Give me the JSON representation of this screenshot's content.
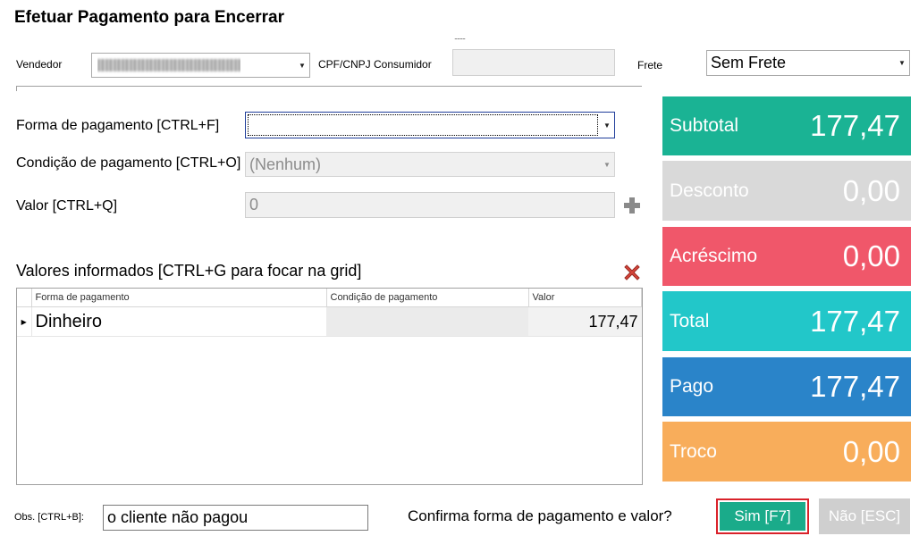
{
  "window": {
    "title": "Efetuar Pagamento para Encerrar",
    "dots": "........"
  },
  "header": {
    "vendedor_label": "Vendedor",
    "cpf_label": "CPF/CNPJ Consumidor",
    "cpf_value": "",
    "frete_label": "Frete",
    "frete_value": "Sem Frete"
  },
  "form": {
    "forma_label": "Forma de pagamento [CTRL+F]",
    "forma_value": "",
    "condicao_label": "Condição de pagamento [CTRL+O]",
    "condicao_value": "(Nenhum)",
    "valor_label": "Valor [CTRL+Q]",
    "valor_value": "0"
  },
  "grid": {
    "title": "Valores informados [CTRL+G para focar na grid]",
    "columns": [
      "Forma de pagamento",
      "Condição de pagamento",
      "Valor"
    ],
    "rows": [
      {
        "forma": "Dinheiro",
        "condicao": "",
        "valor": "177,47"
      }
    ]
  },
  "summary": [
    {
      "label": "Subtotal",
      "value": "177,47",
      "color": "#1ab394"
    },
    {
      "label": "Desconto",
      "value": "0,00",
      "color": "#d9d9d9"
    },
    {
      "label": "Acréscimo",
      "value": "0,00",
      "color": "#f0576a"
    },
    {
      "label": "Total",
      "value": "177,47",
      "color": "#22c7c9"
    },
    {
      "label": "Pago",
      "value": "177,47",
      "color": "#2a84c9"
    },
    {
      "label": "Troco",
      "value": "0,00",
      "color": "#f8ad5b"
    }
  ],
  "footer": {
    "obs_label": "Obs. [CTRL+B]:",
    "obs_value": "o cliente não pagou",
    "confirm_text": "Confirma forma de pagamento e valor?",
    "sim_label": "Sim [F7]",
    "nao_label": "Não [ESC]"
  },
  "icons": {
    "combo_arrow": "▼",
    "row_indicator": "▶",
    "add": "plus-icon",
    "delete": "x-icon"
  }
}
